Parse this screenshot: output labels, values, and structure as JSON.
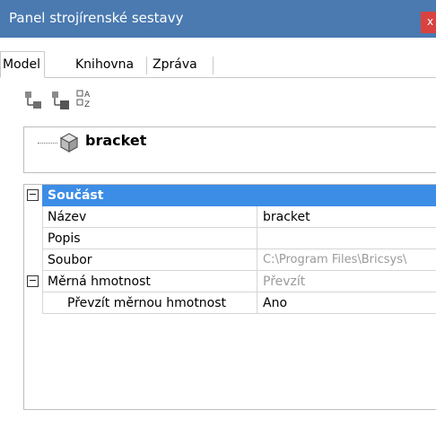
{
  "panel": {
    "title": "Panel strojírenské sestavy",
    "close_label": "x"
  },
  "tabs": [
    {
      "label": "Model",
      "active": true
    },
    {
      "label": "Knihovna",
      "active": false
    },
    {
      "label": "Zpráva",
      "active": false
    }
  ],
  "toolbar": {
    "buttons": [
      {
        "icon": "tree-structure-icon"
      },
      {
        "icon": "tree-structure-alt-icon"
      },
      {
        "icon": "sort-az-icon"
      }
    ],
    "sort_top": "A",
    "sort_bottom": "Z"
  },
  "tree": {
    "root_label": "bracket",
    "icon": "part-cube-icon"
  },
  "properties": {
    "category_label": "Součást",
    "name_label": "Název",
    "name_value": "bracket",
    "description_label": "Popis",
    "description_value": "",
    "file_label": "Soubor",
    "file_value": "C:\\Program Files\\Bricsys\\",
    "density_label": "Měrná hmotnost",
    "density_value": "Převzít",
    "inherit_density_label": "Převzít měrnou hmotnost",
    "inherit_density_value": "Ano"
  },
  "colors": {
    "title_bar": "#4a7ab0",
    "category_row": "#3c8de6",
    "close_button": "#d9423f"
  }
}
